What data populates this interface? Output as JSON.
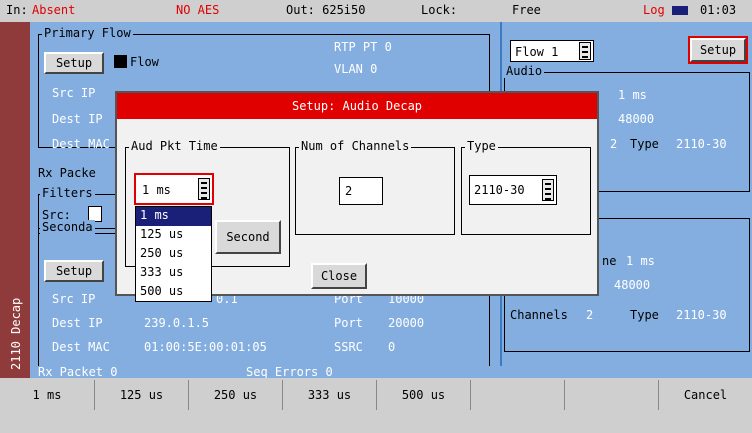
{
  "status": {
    "in_label": "In:",
    "in_value": "Absent",
    "aes": "NO AES",
    "out": "Out: 625i50",
    "lock_label": "Lock:",
    "lock_value": "Free",
    "log": "Log",
    "time": "01:03"
  },
  "side_tab": "2110 Decap",
  "primary": {
    "group_label": "Primary Flow",
    "setup": "Setup",
    "flow": "Flow",
    "rtp_pt": "RTP PT",
    "rtp_pt_val": "0",
    "vlan": "VLAN",
    "vlan_val": "0",
    "src_ip": "Src IP",
    "dest_ip": "Dest IP",
    "dest_mac": "Dest MAC"
  },
  "rx_packet_label": "Rx Packe",
  "filters": {
    "group_label": "Filters",
    "src": "Src:"
  },
  "secondary": {
    "group_label": "Seconda",
    "setup": "Setup",
    "src_ip": "Src IP",
    "src_ip_val": "0.1",
    "port_label_partial": "Port",
    "port_val_partial": "10000",
    "dest_ip": "Dest IP",
    "dest_ip_val": "239.0.1.5",
    "port": "Port",
    "port_val": "20000",
    "dest_mac": "Dest MAC",
    "dest_mac_val": "01:00:5E:00:01:05",
    "ssrc": "SSRC",
    "ssrc_val": "0"
  },
  "rx_row": {
    "label": "Rx Packet",
    "val": "0",
    "seq": "Seq Errors",
    "seq_val": "0"
  },
  "right": {
    "flow_select": "Flow 1",
    "setup": "Setup",
    "audio_label": "Audio",
    "packet_time_partial": "Packet Time",
    "packet_time_val": "1 ms",
    "rate1": "48000",
    "channels_partial": "2",
    "type_label": "Type",
    "type_val": "2110-30",
    "packet_time_val2": "1 ms",
    "rate2": "48000",
    "channels_label": "Channels",
    "channels_val": "2",
    "type_label2": "Type",
    "type_val2": "2110-30",
    "ne_partial": "ne",
    "ne_partial2": "ne"
  },
  "dialog": {
    "title": "Setup: Audio Decap",
    "aud_pkt_time": "Aud Pkt Time",
    "aud_pkt_value": "1 ms",
    "num_channels": "Num of Channels",
    "num_channels_value": "2",
    "type": "Type",
    "type_value": "2110-30",
    "second_button": "Second",
    "close_button": "Close",
    "options": [
      "1 ms",
      "125 us",
      "250 us",
      "333 us",
      "500 us"
    ]
  },
  "softkeys": [
    "1 ms",
    "125 us",
    "250 us",
    "333 us",
    "500 us",
    "",
    "",
    "Cancel"
  ]
}
